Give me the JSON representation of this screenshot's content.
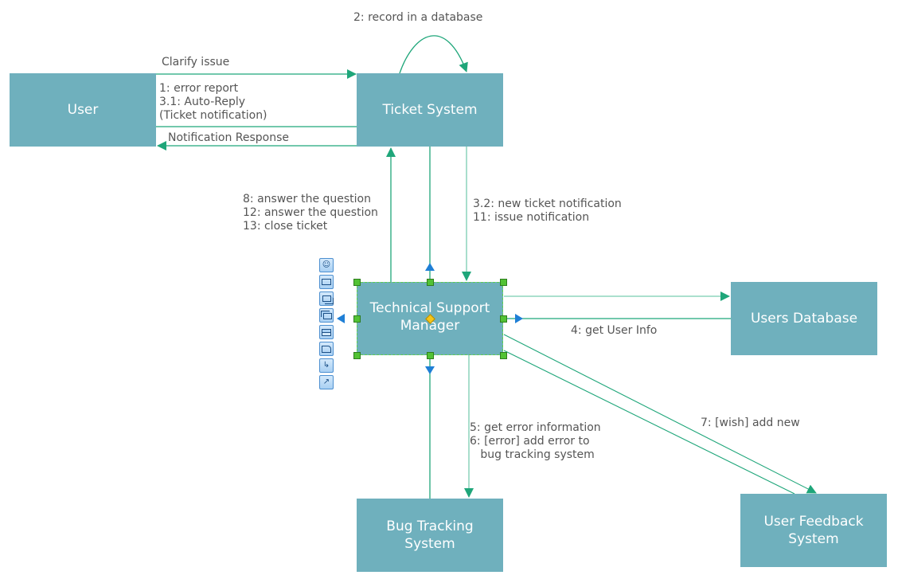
{
  "colors": {
    "node_fill": "#6fb0bd",
    "node_text": "#ffffff",
    "connector": "#1fa67a",
    "connector_light": "#79cdb0",
    "label_text": "#555555",
    "selection": "#5ccf4a",
    "anchor": "#1f7fd6"
  },
  "nodes": {
    "user": "User",
    "ticket_system": "Ticket System",
    "tech_support": "Technical Support\nManager",
    "users_database": "Users Database",
    "bug_tracking": "Bug Tracking\nSystem",
    "user_feedback": "User Feedback\nSystem"
  },
  "messages": {
    "record_db": "2: record in a database",
    "clarify": "Clarify issue",
    "error_report": "1: error report\n3.1: Auto-Reply\n(Ticket notification)",
    "notification_response": "Notification Response",
    "answers": "8: answer the question\n12: answer the question\n13: close ticket",
    "new_ticket": "3.2: new ticket notification\n11: issue notification",
    "get_user_info": "4: get User Info",
    "error_info": "5: get error information\n6: [error] add error to\n   bug tracking system",
    "wish": "7: [wish] add new"
  },
  "toolbar": {
    "tools": [
      "actor-icon",
      "rectangle-icon",
      "multi-object-icon",
      "stacked-frames-icon",
      "split-box-icon",
      "note-icon",
      "connector-step-icon",
      "connector-line-icon"
    ]
  }
}
